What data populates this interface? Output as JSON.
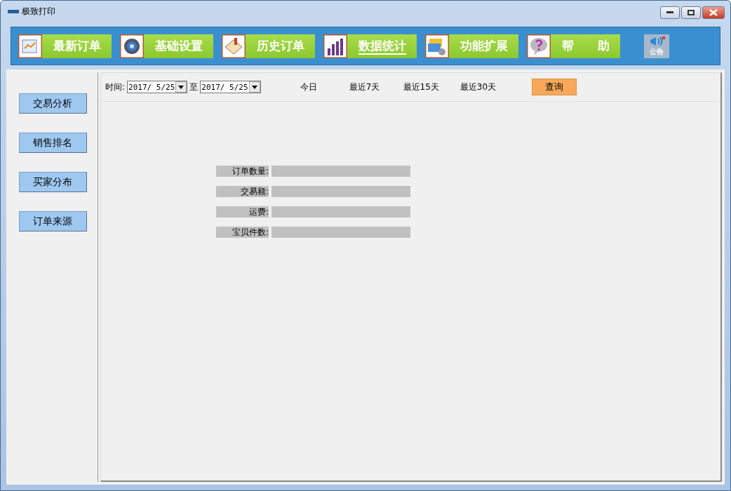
{
  "window": {
    "title": "极致打印"
  },
  "nav": [
    {
      "label": "最新订单",
      "selected": false
    },
    {
      "label": "基础设置",
      "selected": false
    },
    {
      "label": "历史订单",
      "selected": false
    },
    {
      "label": "数据统计",
      "selected": true
    },
    {
      "label": "功能扩展",
      "selected": false
    },
    {
      "label": "帮　　助",
      "selected": false
    }
  ],
  "announcement": {
    "label": "公告"
  },
  "sidebar": {
    "items": [
      "交易分析",
      "销售排名",
      "买家分布",
      "订单来源"
    ]
  },
  "filter": {
    "label": "时间:",
    "from": "2017/ 5/25",
    "separator": "至",
    "to": "2017/ 5/25",
    "quick_ranges": [
      "今日",
      "最近7天",
      "最近15天",
      "最近30天"
    ],
    "query_button": "查询"
  },
  "stats": [
    {
      "label": "订单数量:"
    },
    {
      "label": "交易额:"
    },
    {
      "label": "运费:"
    },
    {
      "label": "宝贝件数:"
    }
  ]
}
